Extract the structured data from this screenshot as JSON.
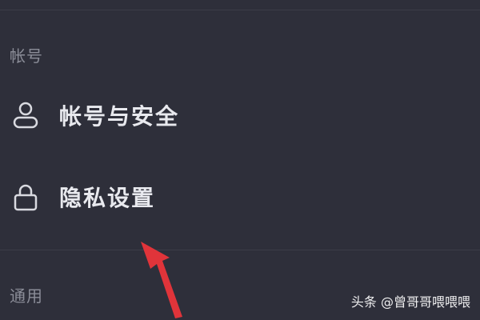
{
  "sections": {
    "account": {
      "header": "帐号",
      "items": [
        {
          "label": "帐号与安全",
          "icon": "user-icon"
        },
        {
          "label": "隐私设置",
          "icon": "lock-icon"
        }
      ]
    },
    "general": {
      "header": "通用"
    }
  },
  "annotation": {
    "arrow_color": "#e0343a"
  },
  "watermark": {
    "text": "头条 @曾哥哥喂喂喂"
  },
  "colors": {
    "background": "#2e2f3a",
    "divider": "#3b3d48",
    "section_text": "#8b8d98",
    "item_text": "#e8e9ee"
  }
}
